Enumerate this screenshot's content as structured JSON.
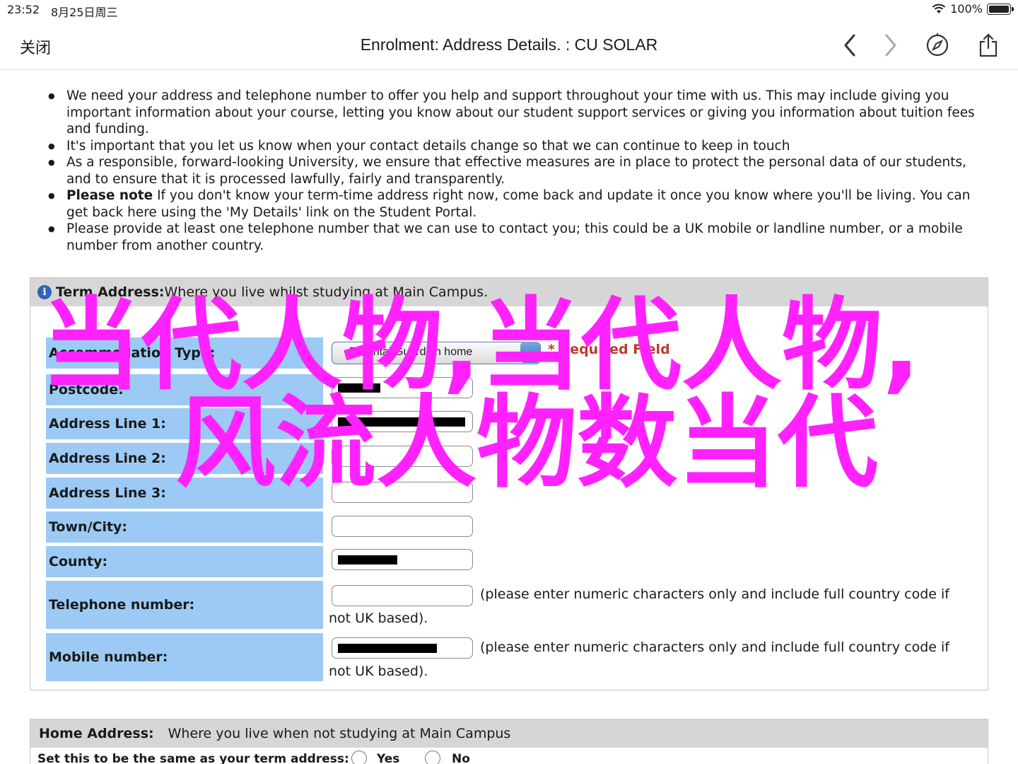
{
  "status": {
    "time": "23:52",
    "date": "8月25日周三",
    "battery": "100%",
    "battery_level": 1.0
  },
  "nav": {
    "close": "关闭",
    "title": "Enrolment: Address Details. : CU SOLAR",
    "icons": [
      "chevron-left-icon",
      "chevron-right-icon",
      "compass-icon",
      "share-icon"
    ]
  },
  "bullets": [
    {
      "bold": "",
      "text": "We need your address and telephone number to offer you help and support throughout your time with us. This may include giving you important information about your course, letting you know about our student support services or giving you information about tuition fees and funding."
    },
    {
      "bold": "",
      "text": "It's important that you let us know when your contact details change so that we can continue to keep in touch"
    },
    {
      "bold": "",
      "text": "As a responsible, forward-looking University, we ensure that effective measures are in place to protect the personal data of our students, and to ensure that it is processed lawfully, fairly and transparently."
    },
    {
      "bold": "Please note",
      "text": " If you don't know your term-time address right now, come back and update it once you know where you'll be living. You can get back here using the 'My Details' link on the Student Portal."
    },
    {
      "bold": "",
      "text": "Please provide at least one telephone number that we can use to contact you; this could be a UK mobile or landline number, or a mobile number from another country."
    }
  ],
  "term": {
    "heading_bold": "Term Address:",
    "heading_text": " Where you live whilst studying at Main Campus.",
    "accommodation_label": "Accommodation Type:",
    "accommodation_value": "Parental/Guardian home",
    "required_text": "* Required Field",
    "postcode_label": "Postcode:",
    "address1_label": "Address Line 1:",
    "address2_label": "Address Line 2:",
    "address3_label": "Address Line 3:",
    "town_label": "Town/City:",
    "county_label": "County:",
    "telephone_label": "Telephone number:",
    "mobile_label": "Mobile number:",
    "phone_note_1": "(please enter numeric characters only and include full country code if",
    "phone_note_2": "not UK based)."
  },
  "home": {
    "heading_bold": "Home Address:",
    "heading_text": "Where you live when not studying at Main Campus",
    "same_label": "Set this to be the same as your term address:",
    "yes": "Yes",
    "no": "No"
  },
  "watermark": {
    "line1": "当代人物,当代人物,",
    "line2": "风流人物数当代",
    "color": "#ff22ff"
  }
}
